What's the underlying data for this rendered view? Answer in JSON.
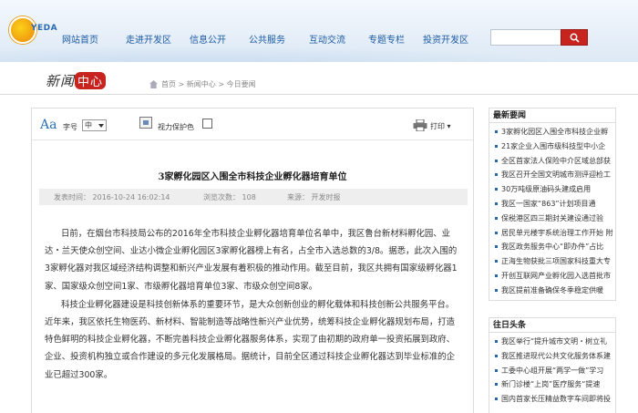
{
  "header": {
    "logo_text": "YEDA",
    "nav": [
      "网站首页",
      "走进开发区",
      "信息公开",
      "公共服务",
      "互动交流",
      "专题专栏",
      "投资开发区"
    ],
    "search": {
      "placeholder": ""
    }
  },
  "band": {
    "title_prefix": "新闻",
    "title_highlight": "中心",
    "breadcrumb": "首页 > 新闻中心 > 今日要闻"
  },
  "toolbar": {
    "font_icon": "Aa",
    "font_label": "字号",
    "font_select": "中",
    "eye_label": "视力保护色",
    "print_label": "打印"
  },
  "article": {
    "title": "3家孵化园区入围全市科技企业孵化器培育单位",
    "published": "发表时间：  2016-10-24 16:02:14",
    "views": "浏览次数：  108",
    "source": "来源：  开发时报",
    "paragraphs": [
      "日前，在烟台市科技局公布的2016年全市科技企业孵化器培育单位名单中，我区鲁台新材料孵化园、业达・兰天使众创空间、业达小微企业孵化园区3家孵化器榜上有名，占全市入选总数的3/8。据悉，此次入围的3家孵化器对我区域经济结构调整和新兴产业发展有着积极的推动作用。截至目前，我区共拥有国家级孵化器1家、国家级众创空间1家、市级孵化器培育单位3家、市级众创空间8家。",
      "科技企业孵化器建设是科技创新体系的重要环节，是大众创新创业的孵化载体和科技创新公共服务平台。近年来，我区依托生物医药、新材料、智能制造等战略性新兴产业优势，统筹科技企业孵化器规划布局，打造特色鲜明的科技企业孵化器，不断完善科技企业孵化器服务体系，实现了由初期的政府单一投资拓展到政府、企业、投资机构独立或合作建设的多元化发展格局。据统计，目前全区通过科技企业孵化器达到毕业标准的企业已超过300家。"
    ]
  },
  "sidebar": {
    "latest_title": "最新要闻",
    "latest": [
      "3家孵化园区入围全市科技企业孵",
      "21家企业入围市级科技型中小企",
      "全区首家法人保险中介区域总部获",
      "我区召开全国文明城市测评迎检工",
      "30万吨级原油码头建成启用",
      "我区一国家“863”计划项目通",
      "保税港区四三期封关建设通过验",
      "居民单元楼宇系统治理工作开始 附",
      "我区政务服务中心“即办件”占比",
      "正海生物获批三项国家科技重大专",
      "开创互联网产业孵化园入选首批市",
      "我区提前准备确保冬季稳定供暖"
    ],
    "past_title": "往日头条",
    "past": [
      "我区举行“提升城市文明・树立礼",
      "我区推进现代公共文化服务体系建",
      "工委中心组开展“两学一做”学习",
      "新门诊楼“上岗”医疗服务“提速",
      "国内首家长压精益数字车间即将投"
    ]
  }
}
